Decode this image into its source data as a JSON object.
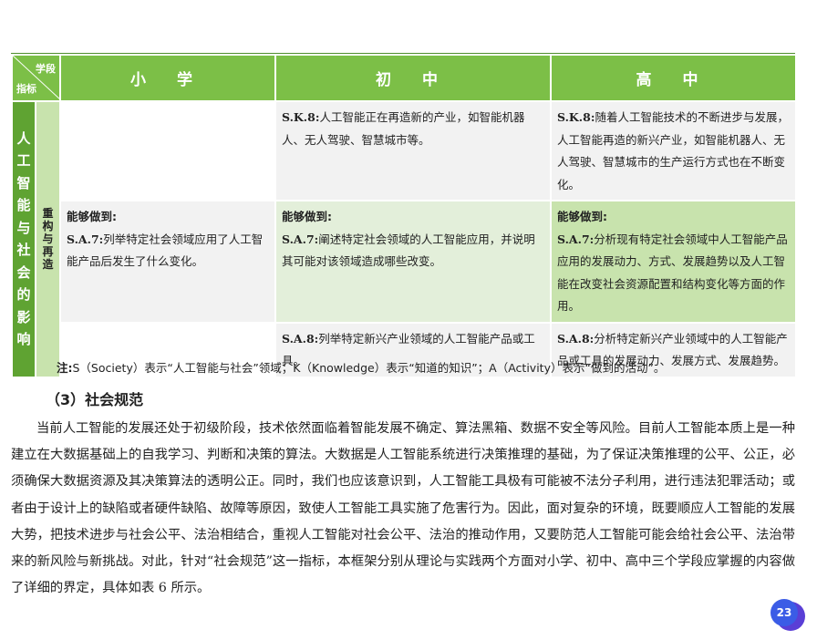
{
  "table": {
    "corner_top": "学段",
    "corner_bottom": "指标",
    "headers": [
      "小  学",
      "初  中",
      "高  中"
    ],
    "dimension": "人工智能与社会的影响",
    "sub_dimension": "重构与再造",
    "row1": {
      "primary": "",
      "middle_code": "S.K.8:",
      "middle_text": "人工智能正在再造新的产业，如智能机器人、无人驾驶、智慧城市等。",
      "high_code": "S.K.8:",
      "high_text": "随着人工智能技术的不断进步与发展，人工智能再造的新兴产业，如智能机器人、无人驾驶、智慧城市的生产运行方式也在不断变化。"
    },
    "can_label": "能够做到:",
    "row2": {
      "primary_code": "S.A.7:",
      "primary_text": "列举特定社会领域应用了人工智能产品后发生了什么变化。",
      "middle_code": "S.A.7:",
      "middle_text": "阐述特定社会领域的人工智能应用，并说明其可能对该领域造成哪些改变。",
      "high_code": "S.A.7:",
      "high_text": "分析现有特定社会领域中人工智能产品应用的发展动力、方式、发展趋势以及人工智能在改变社会资源配置和结构变化等方面的作用。"
    },
    "row3": {
      "primary": "",
      "middle_code": "S.A.8:",
      "middle_text": "列举特定新兴产业领域的人工智能产品或工具。",
      "high_code": "S.A.8:",
      "high_text": "分析特定新兴产业领域中的人工智能产品或工具的发展动力、发展方式、发展趋势。"
    }
  },
  "note": {
    "label": "注:",
    "text": "S（Society）表示“人工智能与社会”领域；K（Knowledge）表示“知道的知识”；A（Activity）表示“做到的活动”。"
  },
  "section_heading": "（3）社会规范",
  "paragraph": "当前人工智能的发展还处于初级阶段，技术依然面临着智能发展不确定、算法黑箱、数据不安全等风险。目前人工智能本质上是一种建立在大数据基础上的自我学习、判断和决策的算法。大数据是人工智能系统进行决策推理的基础，为了保证决策推理的公平、公正，必须确保大数据资源及其决策算法的透明公正。同时，我们也应该意识到，人工智能工具极有可能被不法分子利用，进行违法犯罪活动；或者由于设计上的缺陷或者硬件缺陷、故障等原因，致使人工智能工具实施了危害行为。因此，面对复杂的环境，既要顺应人工智能的发展大势，把技术进步与社会公平、法治相结合，重视人工智能对社会公平、法治的推动作用，又要防范人工智能可能会给社会公平、法治带来的新风险与新挑战。对此，针对“社会规范”这一指标，本框架分别从理论与实践两个方面对小学、初中、高中三个学段应掌握的内容做了详细的界定，具体如表 6 所示。",
  "page_number": "23",
  "colors": {
    "header_green": "#7cbf47",
    "dimension_green": "#5fa332",
    "light_green": "#c8e3ad",
    "pale_green": "#e3efda",
    "grey": "#f2f2f2",
    "badge_blue": "#3b5ce6"
  }
}
